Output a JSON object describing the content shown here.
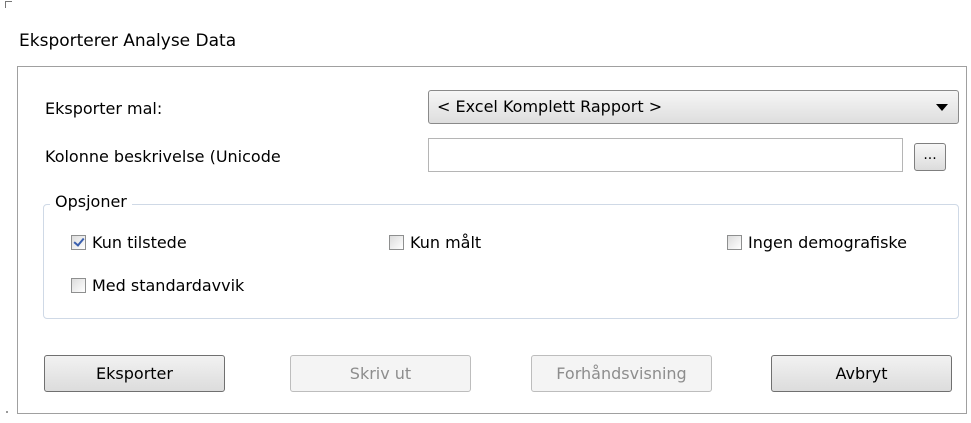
{
  "dialog": {
    "title": "Eksporterer Analyse Data"
  },
  "form": {
    "template_label": "Eksporter mal:",
    "template_selected": "< Excel Komplett Rapport >",
    "column_desc_label": "Kolonne beskrivelse (Unicode",
    "column_desc_value": "",
    "browse_label": "..."
  },
  "options": {
    "legend": "Opsjoner",
    "items": [
      {
        "label": "Kun tilstede",
        "checked": true
      },
      {
        "label": "Kun målt",
        "checked": false
      },
      {
        "label": "Ingen demografiske",
        "checked": false
      },
      {
        "label": "Med standardavvik",
        "checked": false
      }
    ]
  },
  "buttons": {
    "export": "Eksporter",
    "print": "Skriv ut",
    "preview": "Forhåndsvisning",
    "cancel": "Avbryt"
  }
}
